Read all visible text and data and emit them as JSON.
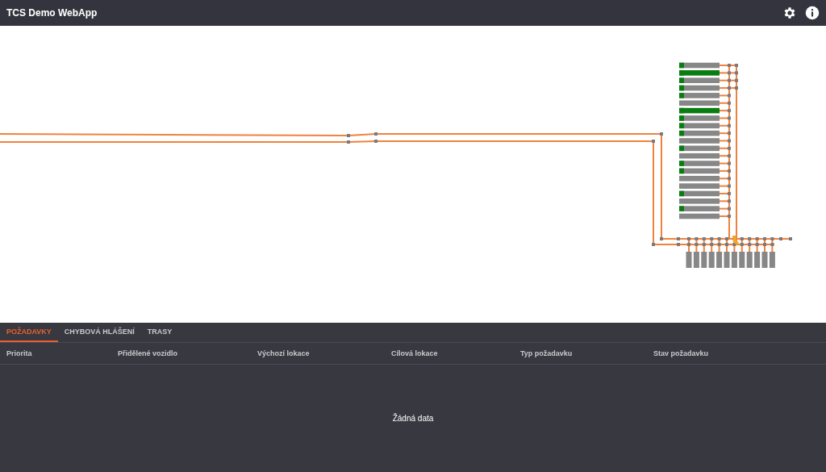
{
  "app_bar": {
    "title": "TCS Demo WebApp"
  },
  "layout": {
    "racks": [
      {
        "occupied": true,
        "highlighted": false
      },
      {
        "occupied": true,
        "highlighted": true
      },
      {
        "occupied": true,
        "highlighted": false
      },
      {
        "occupied": true,
        "highlighted": false
      },
      {
        "occupied": true,
        "highlighted": false
      },
      {
        "occupied": false,
        "highlighted": false
      },
      {
        "occupied": true,
        "highlighted": true
      },
      {
        "occupied": true,
        "highlighted": false
      },
      {
        "occupied": true,
        "highlighted": false
      },
      {
        "occupied": true,
        "highlighted": false
      },
      {
        "occupied": false,
        "highlighted": false
      },
      {
        "occupied": true,
        "highlighted": false
      },
      {
        "occupied": false,
        "highlighted": false
      },
      {
        "occupied": true,
        "highlighted": false
      },
      {
        "occupied": true,
        "highlighted": false
      },
      {
        "occupied": false,
        "highlighted": false
      },
      {
        "occupied": false,
        "highlighted": false
      },
      {
        "occupied": true,
        "highlighted": false
      },
      {
        "occupied": false,
        "highlighted": false
      },
      {
        "occupied": true,
        "highlighted": false
      },
      {
        "occupied": false,
        "highlighted": false
      }
    ]
  },
  "tabs": [
    {
      "label": "POŽADAVKY",
      "selected": true
    },
    {
      "label": "CHYBOVÁ HLÁŠENÍ",
      "selected": false
    },
    {
      "label": "TRASY",
      "selected": false
    }
  ],
  "table": {
    "columns": [
      "Priorita",
      "Přidělené vozidlo",
      "Výchozí lokace",
      "Cílová lokace",
      "Typ požadavku",
      "Stav požadavku"
    ],
    "empty_message": "Žádná data"
  }
}
